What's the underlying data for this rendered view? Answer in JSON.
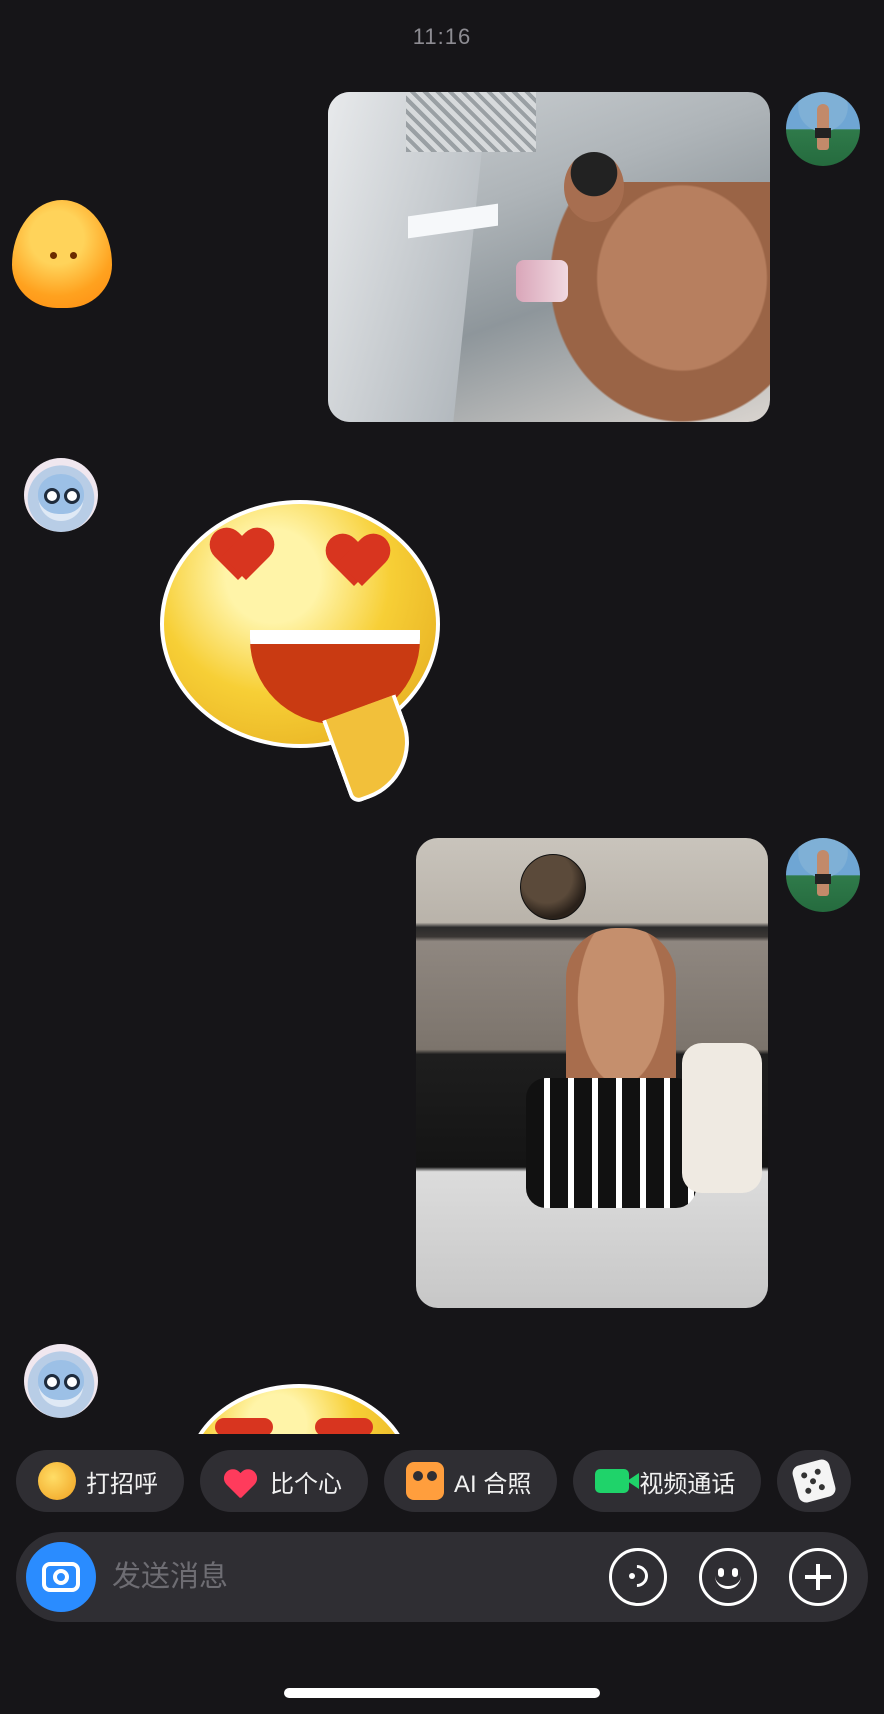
{
  "chat": {
    "timestamp": "11:16",
    "messages": [
      {
        "from": "me",
        "kind": "photo",
        "desc": "mirror selfie"
      },
      {
        "from": "other",
        "kind": "sticker",
        "sticker": "orange-drop"
      },
      {
        "from": "other",
        "kind": "sticker",
        "sticker": "heart-eyes-emoji"
      },
      {
        "from": "me",
        "kind": "photo",
        "desc": "basketball selfie"
      },
      {
        "from": "other",
        "kind": "sticker",
        "sticker": "heart-eyes-emoji"
      }
    ]
  },
  "quick_actions": [
    {
      "label": "打招呼",
      "icon": "wave-icon"
    },
    {
      "label": "比个心",
      "icon": "heart-icon"
    },
    {
      "label": "AI 合照",
      "icon": "ai-photo-icon"
    },
    {
      "label": "视频通话",
      "icon": "video-call-icon"
    },
    {
      "label": "",
      "icon": "dice-icon"
    }
  ],
  "composer": {
    "placeholder": "发送消息"
  },
  "colors": {
    "background": "#161518",
    "chip_bg": "#2f2e33",
    "camera_blue": "#2a8cff",
    "video_green": "#1fd36a"
  }
}
